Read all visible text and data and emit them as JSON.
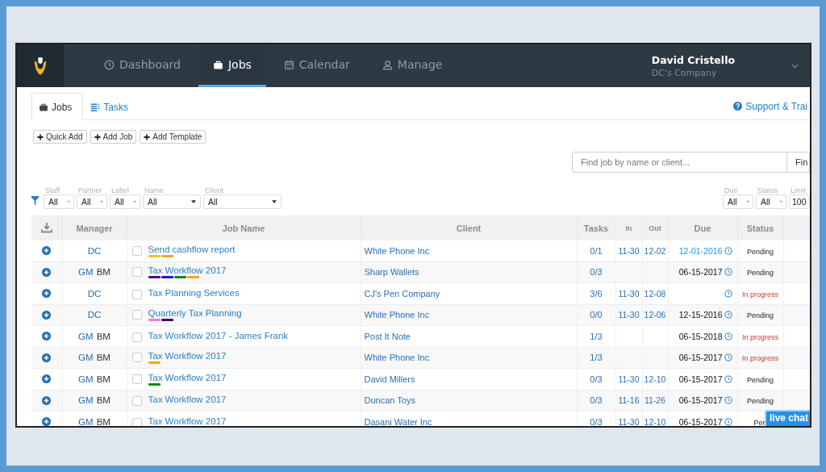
{
  "nav": {
    "items": [
      {
        "label": "Dashboard",
        "selected": false
      },
      {
        "label": "Jobs",
        "selected": true
      },
      {
        "label": "Calendar",
        "selected": false
      },
      {
        "label": "Manage",
        "selected": false
      }
    ],
    "user": {
      "name": "David Cristello",
      "company": "DC's Company"
    }
  },
  "tabs": [
    {
      "label": "Jobs",
      "selected": true
    },
    {
      "label": "Tasks",
      "selected": false
    }
  ],
  "support_link": "Support & Trai",
  "actions": [
    "Quick Add",
    "Add Job",
    "Add Template"
  ],
  "search": {
    "placeholder": "Find job by name or client...",
    "button": "Fin"
  },
  "filters_left": [
    {
      "label": "Staff",
      "value": "All",
      "kind": "select"
    },
    {
      "label": "Partner",
      "value": "All",
      "kind": "select"
    },
    {
      "label": "Label",
      "value": "All",
      "kind": "select"
    },
    {
      "label": "Name",
      "value": "All",
      "kind": "wide"
    },
    {
      "label": "Client",
      "value": "All",
      "kind": "wide"
    }
  ],
  "filters_right": [
    {
      "label": "Due",
      "value": "All",
      "kind": "select"
    },
    {
      "label": "Status",
      "value": "All",
      "kind": "select"
    },
    {
      "label": "Limit",
      "value": "100",
      "kind": "input"
    }
  ],
  "table": {
    "columns": [
      "Manager",
      "Job Name",
      "Client",
      "Tasks",
      "In",
      "Out",
      "Due",
      "Status"
    ],
    "rows": [
      {
        "managers": [
          {
            "initials": "DC",
            "lead": true
          }
        ],
        "job": "Send cashflow report",
        "checked": false,
        "labels": [
          {
            "color": "#f5c518"
          },
          {
            "color": "#f5a623"
          }
        ],
        "client": "White Phone Inc",
        "tasks": "0/1",
        "in": "11-30",
        "out": "12-02",
        "due": "12-01-2016",
        "due_highlight": true,
        "status": {
          "text": "Pending",
          "kind": "pending"
        }
      },
      {
        "managers": [
          {
            "initials": "GM",
            "lead": true
          },
          {
            "initials": "BM",
            "lead": false
          }
        ],
        "job": "Tax Workflow 2017",
        "checked": false,
        "labels": [
          {
            "color": "#4b0e82"
          },
          {
            "color": "#1a1ad6"
          },
          {
            "color": "#13891a"
          },
          {
            "color": "#f5a623"
          }
        ],
        "client": "Sharp Wallets",
        "tasks": "0/3",
        "due": "06-15-2017",
        "due_highlight": false,
        "status": {
          "text": "Pending",
          "kind": "pending"
        }
      },
      {
        "managers": [
          {
            "initials": "DC",
            "lead": true
          }
        ],
        "job": "Tax Planning Services",
        "checked": false,
        "client": "CJ's Pen Company",
        "tasks": "3/6",
        "in": "11-30",
        "out": "12-08",
        "status": {
          "text": "In progress",
          "kind": "progress"
        }
      },
      {
        "managers": [
          {
            "initials": "DC",
            "lead": true
          }
        ],
        "job": "Quarterly Tax Planning",
        "checked": false,
        "labels": [
          {
            "color": "#e87de0"
          },
          {
            "color": "#3d0a70"
          }
        ],
        "client": "White Phone Inc",
        "tasks": "0/0",
        "in": "11-30",
        "out": "12-06",
        "due": "12-15-2016",
        "due_highlight": false,
        "status": {
          "text": "Pending",
          "kind": "pending"
        }
      },
      {
        "managers": [
          {
            "initials": "GM",
            "lead": true
          },
          {
            "initials": "BM",
            "lead": false
          }
        ],
        "job": "Tax Workflow 2017 - James Frank",
        "checked": false,
        "client": "Post It Note",
        "tasks": "1/3",
        "due": "06-15-2018",
        "due_highlight": false,
        "status": {
          "text": "In progress",
          "kind": "progress"
        }
      },
      {
        "managers": [
          {
            "initials": "GM",
            "lead": true
          },
          {
            "initials": "BM",
            "lead": false
          }
        ],
        "job": "Tax Workflow 2017",
        "checked": false,
        "labels": [
          {
            "color": "#f5a623"
          }
        ],
        "client": "White Phone Inc",
        "tasks": "1/3",
        "due": "06-15-2017",
        "due_highlight": false,
        "status": {
          "text": "In progress",
          "kind": "progress"
        }
      },
      {
        "managers": [
          {
            "initials": "GM",
            "lead": true
          },
          {
            "initials": "BM",
            "lead": false
          }
        ],
        "job": "Tax Workflow 2017",
        "checked": false,
        "labels": [
          {
            "color": "#13891a"
          }
        ],
        "client": "David Millers",
        "tasks": "0/3",
        "in": "11-30",
        "out": "12-10",
        "due": "06-15-2017",
        "due_highlight": false,
        "status": {
          "text": "Pending",
          "kind": "pending"
        }
      },
      {
        "managers": [
          {
            "initials": "GM",
            "lead": true
          },
          {
            "initials": "BM",
            "lead": false
          }
        ],
        "job": "Tax Workflow 2017",
        "checked": false,
        "client": "Duncan Toys",
        "tasks": "0/3",
        "in": "11-16",
        "out": "11-26",
        "due": "06-15-2017",
        "due_highlight": false,
        "status": {
          "text": "Pending",
          "kind": "pending"
        }
      },
      {
        "managers": [
          {
            "initials": "GM",
            "lead": true
          },
          {
            "initials": "BM",
            "lead": false
          }
        ],
        "job": "Tax Workflow 2017",
        "checked": false,
        "client": "Dasani Water Inc",
        "tasks": "0/3",
        "in": "11-30",
        "out": "12-10",
        "due": "06-15-2017",
        "due_highlight": false,
        "status": {
          "text": "Pen",
          "kind": "pending"
        }
      }
    ]
  },
  "live_chat": "live chat"
}
